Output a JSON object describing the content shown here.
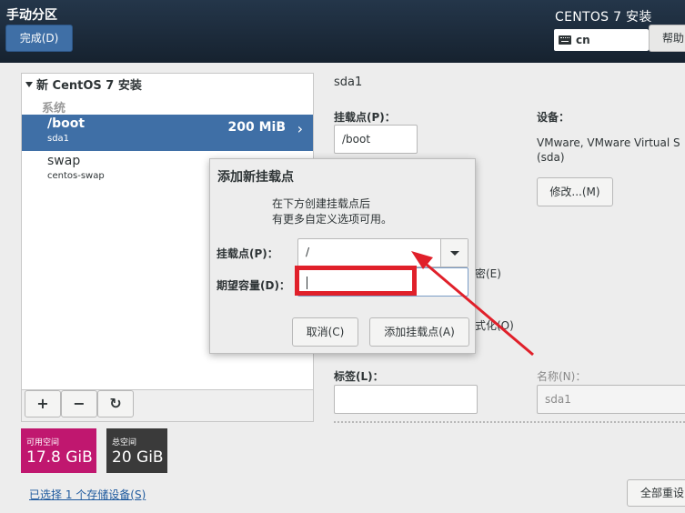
{
  "header": {
    "title": "手动分区",
    "done_label": "完成(D)",
    "product": "CENTOS 7 安装",
    "keyboard": "cn",
    "help_label": "帮助"
  },
  "tree": {
    "root": "新 CentOS 7 安装",
    "section": "系统",
    "items": [
      {
        "name": "/boot",
        "device": "sda1",
        "size": "200 MiB",
        "selected": true
      },
      {
        "name": "swap",
        "device": "centos-swap",
        "size": "",
        "selected": false
      }
    ]
  },
  "toolbar": {
    "add": "+",
    "remove": "−",
    "refresh": "↻"
  },
  "space": {
    "available_label": "可用空间",
    "available_value": "17.8 GiB",
    "available_color": "#c0176f",
    "total_label": "总空间",
    "total_value": "20 GiB",
    "total_color": "#3a3a3a"
  },
  "storage_link": "已选择 1 个存储设备(S)",
  "reset_label": "全部重设",
  "detail": {
    "device_title": "sda1",
    "mount_label": "挂载点(P)：",
    "mount_value": "/boot",
    "device_label": "设备：",
    "device_desc": "VMware, VMware Virtual S",
    "device_sub": "(sda)",
    "modify_label": "修改...(M)",
    "encrypt_partial": "密(E)",
    "format_partial": "式化(O)",
    "tag_label": "标签(L)：",
    "name_label": "名称(N)：",
    "name_value": "sda1"
  },
  "dialog": {
    "title": "添加新挂载点",
    "desc_line1": "在下方创建挂载点后",
    "desc_line2": "有更多自定义选项可用。",
    "mount_label": "挂载点(P)：",
    "mount_value": "/",
    "capacity_label": "期望容量(D)：",
    "capacity_value": "",
    "cancel_label": "取消(C)",
    "add_label": "添加挂载点(A)"
  },
  "annotation_color": "#e0202a"
}
